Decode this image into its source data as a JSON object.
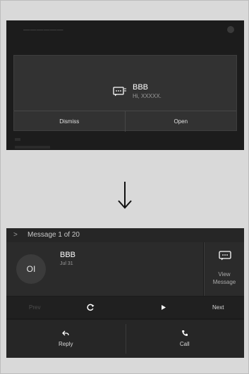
{
  "top_screen": {
    "notification": {
      "sender": "BBB",
      "preview": "Hi, XXXXX.",
      "dismiss_label": "Dismiss",
      "open_label": "Open"
    }
  },
  "bottom_screen": {
    "header": {
      "chevron": ">",
      "title": "Message 1 of 20"
    },
    "contact": {
      "initials": "OI",
      "name": "BBB",
      "date": "Jul 31"
    },
    "view_message": {
      "line1": "View",
      "line2": "Message"
    },
    "controls": {
      "prev_label": "Prev",
      "next_label": "Next"
    },
    "actions": {
      "reply_label": "Reply",
      "call_label": "Call"
    }
  },
  "colors": {
    "page_bg": "#d9d9d9",
    "screen_bg": "#1c1c1c",
    "panel_bg": "#323232",
    "text_primary": "#ffffff",
    "text_disabled": "#4d4d4d"
  },
  "icons": {
    "notification_message": "message-bubble-icon",
    "arrow": "down-arrow-icon",
    "view_message": "message-bubble-icon",
    "repeat": "repeat-icon",
    "play": "play-icon",
    "reply": "reply-icon",
    "call": "phone-icon"
  }
}
